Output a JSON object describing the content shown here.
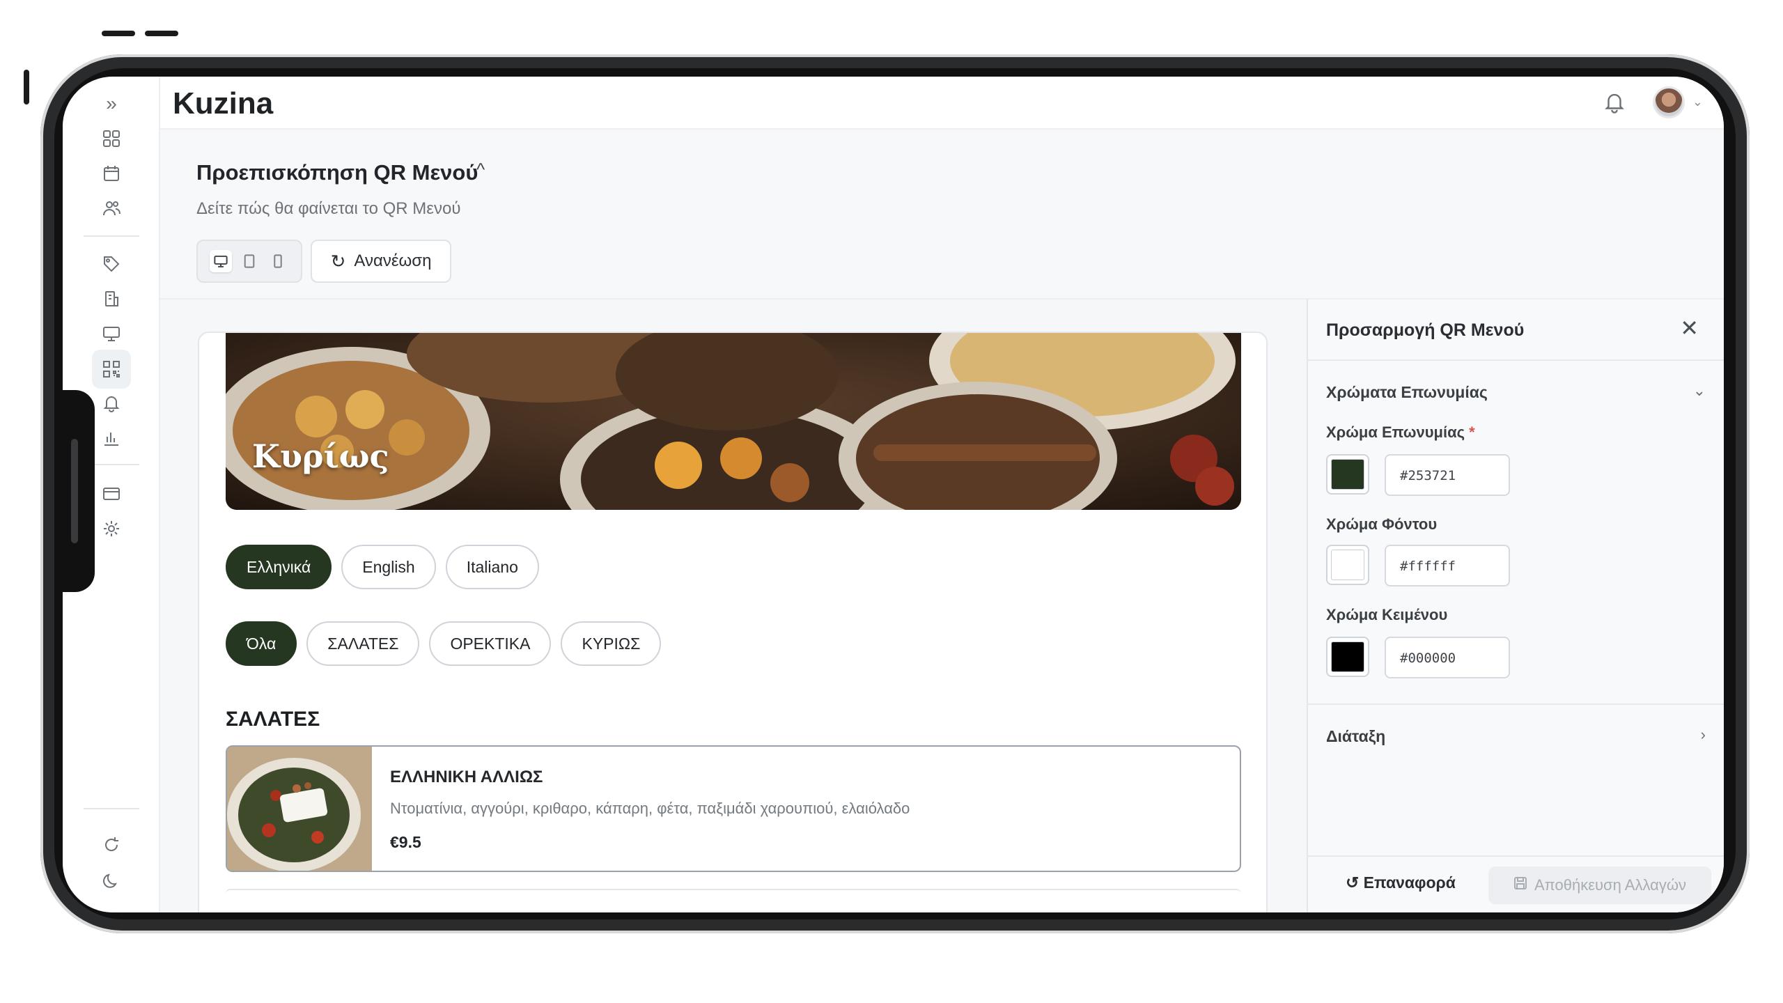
{
  "app": {
    "brand": "Kuzina"
  },
  "header": {
    "title": "Προεπισκόπηση QR Μενού",
    "subtitle": "Δείτε πώς θα φαίνεται το QR Μενού",
    "refresh_label": "Ανανέωση"
  },
  "preview": {
    "hero_title": "Κυρίως",
    "languages": [
      "Ελληνικά",
      "English",
      "Italiano"
    ],
    "active_language": "Ελληνικά",
    "categories": [
      "Όλα",
      "ΣΑΛΑΤΕΣ",
      "ΟΡΕΚΤΙΚΑ",
      "ΚΥΡΙΩΣ"
    ],
    "active_category": "Όλα",
    "section_title": "ΣΑΛΑΤΕΣ",
    "item": {
      "name": "ΕΛΛΗΝΙΚΗ ΑΛΛΙΩΣ",
      "description": "Ντοματίνια, αγγούρι, κριθαρο, κάπαρη, φέτα, παξιμάδι χαρουπιού, ελαιόλαδο",
      "price": "€9.5"
    }
  },
  "panel": {
    "title": "Προσαρμογή QR Μενού",
    "brand_colors_heading": "Χρώματα Επωνυμίας",
    "fields": [
      {
        "label": "Χρώμα Επωνυμίας",
        "required_mark": "*",
        "value": "#253721"
      },
      {
        "label": "Χρώμα Φόντου",
        "value": "#ffffff"
      },
      {
        "label": "Χρώμα Κειμένου",
        "value": "#000000"
      }
    ],
    "layout_heading": "Διάταξη",
    "reset_label": "Επαναφορά",
    "save_label": "Αποθήκευση Αλλαγών"
  },
  "colors": {
    "brand_accent": "#253721",
    "background": "#ffffff",
    "text": "#000000"
  },
  "icons": {
    "rail": [
      "expand-icon",
      "dashboard-icon",
      "calendar-icon",
      "users-icon",
      "tag-icon",
      "building-icon",
      "monitor-icon",
      "qr-code-icon",
      "bell-icon",
      "chart-icon",
      "card-icon",
      "settings-icon",
      "refresh-icon",
      "moon-icon"
    ]
  }
}
